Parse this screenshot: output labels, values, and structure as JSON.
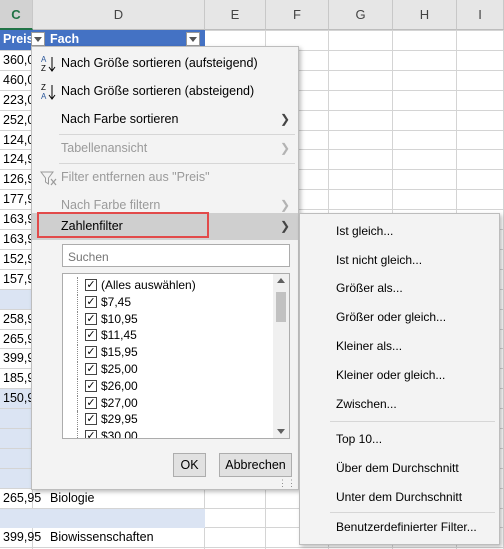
{
  "columns": [
    "C",
    "D",
    "E",
    "F",
    "G",
    "H",
    "I"
  ],
  "headers": {
    "preis": "Preis",
    "fach": "Fach"
  },
  "c_values": [
    "360,0",
    "460,0",
    "223,0",
    "252,0",
    "124,0",
    "124,9",
    "126,9",
    "177,9",
    "163,9",
    "163,9",
    "152,9",
    "157,9",
    "",
    "258,9",
    "265,9",
    "399,9",
    "185,9",
    "150,9",
    "",
    "",
    "",
    "",
    "265,95",
    "",
    "399,95"
  ],
  "d_values": [
    "",
    "",
    "",
    "",
    "",
    "",
    "",
    "",
    "",
    "",
    "",
    "",
    "",
    "",
    "",
    "",
    "",
    "",
    "",
    "",
    "",
    "",
    "Biologie",
    "",
    "Biowissenschaften"
  ],
  "menu": {
    "sort_asc": "Nach Größe sortieren (aufsteigend)",
    "sort_desc": "Nach Größe sortieren (absteigend)",
    "sort_color": "Nach Farbe sortieren",
    "sheet_view": "Tabellenansicht",
    "clear_filter": "Filter entfernen aus \"Preis\"",
    "filter_color": "Nach Farbe filtern",
    "number_filter": "Zahlenfilter",
    "search_placeholder": "Suchen",
    "list_items": [
      "(Alles auswählen)",
      "$7,45",
      "$10,95",
      "$11,45",
      "$15,95",
      "$25,00",
      "$26,00",
      "$27,00",
      "$29,95",
      "$30,00"
    ],
    "ok": "OK",
    "cancel": "Abbrechen"
  },
  "submenu": {
    "items": [
      "Ist gleich...",
      "Ist nicht gleich...",
      "Größer als...",
      "Größer oder gleich...",
      "Kleiner als...",
      "Kleiner oder gleich...",
      "Zwischen...",
      "Top 10...",
      "Über dem Durchschnitt",
      "Unter dem Durchschnitt",
      "Benutzerdefinierter Filter..."
    ]
  },
  "icons": {
    "sort_asc": "sort-ascending-icon",
    "sort_desc": "sort-descending-icon",
    "clear_filter": "clear-filter-icon",
    "chevron": "chevron-right-icon",
    "checkbox": "checkmark-icon"
  },
  "colors": {
    "header_blue": "#4472c4",
    "row_blue": "#dbe4f3",
    "highlight": "#e24a4a",
    "excel_green": "#217346"
  }
}
